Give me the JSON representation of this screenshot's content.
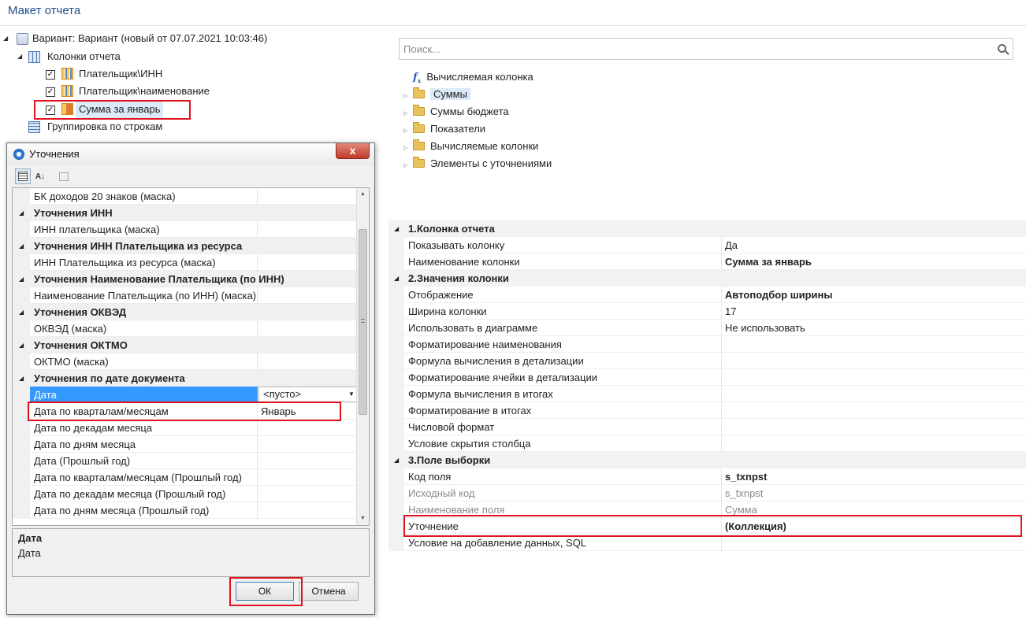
{
  "window": {
    "title": "Макет отчета"
  },
  "tree": {
    "variant": "Вариант: Вариант (новый от 07.07.2021 10:03:46)",
    "columns_node": "Колонки отчета",
    "columns": [
      {
        "label": "Плательщик\\ИНН",
        "checked": "✓"
      },
      {
        "label": "Плательщик\\наименование",
        "checked": "✓"
      },
      {
        "label": "Сумма за январь",
        "checked": "✓"
      }
    ],
    "grouping": "Группировка по строкам"
  },
  "search": {
    "placeholder": "Поиск..."
  },
  "fields_tree": [
    {
      "label": "Вычисляемая колонка",
      "icon": "fx-icon"
    },
    {
      "label": "Суммы",
      "icon": "folder-icon"
    },
    {
      "label": "Суммы бюджета",
      "icon": "folder-icon"
    },
    {
      "label": "Показатели",
      "icon": "folder-icon"
    },
    {
      "label": "Вычисляемые колонки",
      "icon": "folder-icon"
    },
    {
      "label": "Элементы с уточнениями",
      "icon": "folder-icon"
    }
  ],
  "properties": {
    "cat1": "1.Колонка отчета",
    "cat1_rows": [
      {
        "k": "Показывать колонку",
        "v": "Да"
      },
      {
        "k": "Наименование колонки",
        "v": "Сумма за январь"
      }
    ],
    "cat2": "2.Значения колонки",
    "cat2_rows": [
      {
        "k": "Отображение",
        "v": "Автоподбор ширины"
      },
      {
        "k": "Ширина колонки",
        "v": "17"
      },
      {
        "k": "Использовать в диаграмме",
        "v": "Не использовать"
      },
      {
        "k": "Форматирование наименования",
        "v": ""
      },
      {
        "k": "Формула вычисления в детализации",
        "v": ""
      },
      {
        "k": "Форматирование ячейки в детализации",
        "v": ""
      },
      {
        "k": "Формула вычисления в итогах",
        "v": ""
      },
      {
        "k": "Форматирование в итогах",
        "v": ""
      },
      {
        "k": "Числовой формат",
        "v": ""
      },
      {
        "k": "Условие скрытия столбца",
        "v": ""
      }
    ],
    "cat3": "3.Поле выборки",
    "cat3_rows": [
      {
        "k": "Код поля",
        "v": "s_txnpst"
      },
      {
        "k": "Исходный код",
        "v": "s_txnpst"
      },
      {
        "k": "Наименование поля",
        "v": "Сумма"
      },
      {
        "k": "Уточнение",
        "v": "(Коллекция)"
      },
      {
        "k": "Условие на добавление данных, SQL",
        "v": ""
      }
    ]
  },
  "dialog": {
    "title": "Уточнения",
    "close": "x",
    "toolbar": {
      "sort_label": "A↓"
    },
    "grid": {
      "r0": "БК доходов 20 знаков (маска)",
      "c1": "Уточнения ИНН",
      "r1": "ИНН плательщика (маска)",
      "c2": "Уточнения ИНН Плательщика из ресурса",
      "r2": "ИНН Плательщика из ресурса (маска)",
      "c3": "Уточнения Наименование Плательщика (по ИНН)",
      "r3": "Наименование Плательщика (по ИНН) (маска)",
      "c4": "Уточнения ОКВЭД",
      "r4": "ОКВЭД (маска)",
      "c5": "Уточнения ОКТМО",
      "r5": "ОКТМО (маска)",
      "c6": "Уточнения по дате документа",
      "date": {
        "k": "Дата",
        "v": "<пусто>"
      },
      "rows6": [
        {
          "k": "Дата по кварталам/месяцам",
          "v": "Январь"
        },
        {
          "k": "Дата по декадам месяца",
          "v": ""
        },
        {
          "k": "Дата по дням месяца",
          "v": ""
        },
        {
          "k": "Дата (Прошлый год)",
          "v": ""
        },
        {
          "k": "Дата по кварталам/месяцам (Прошлый год)",
          "v": ""
        },
        {
          "k": "Дата по декадам месяца (Прошлый год)",
          "v": ""
        },
        {
          "k": "Дата по дням месяца (Прошлый год)",
          "v": ""
        }
      ]
    },
    "desc": {
      "title": "Дата",
      "text": "Дата"
    },
    "ok": "ОК",
    "cancel": "Отмена"
  }
}
